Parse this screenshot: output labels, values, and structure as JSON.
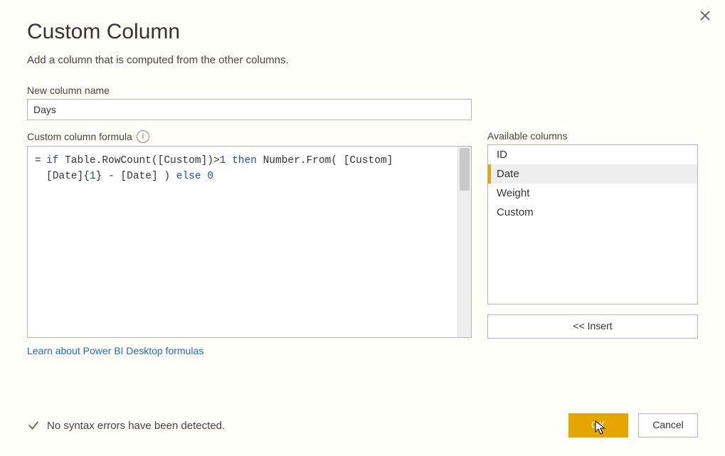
{
  "dialog": {
    "title": "Custom Column",
    "subtitle": "Add a column that is computed from the other columns.",
    "close_tooltip": "Close"
  },
  "fields": {
    "new_col_label": "New column name",
    "new_col_value": "Days",
    "formula_label": "Custom column formula",
    "formula_tokens": {
      "kw_if": "if",
      "fn_rowcount": "Table.RowCount([Custom])",
      "gt": ">",
      "one": "1",
      "kw_then": "then",
      "fn_numfrom": "Number.From( [Custom]",
      "line2a": "[Date]{",
      "idx1": "1",
      "line2b": "} - [Date] )",
      "kw_else": "else",
      "zero": "0"
    }
  },
  "link": {
    "learn_text": "Learn about Power BI Desktop formulas"
  },
  "available": {
    "label": "Available columns",
    "items": [
      "ID",
      "Date",
      "Weight",
      "Custom"
    ],
    "selected_index": 1,
    "insert_label": "<< Insert"
  },
  "status": {
    "message": "No syntax errors have been detected."
  },
  "buttons": {
    "ok": "OK",
    "cancel": "Cancel"
  }
}
